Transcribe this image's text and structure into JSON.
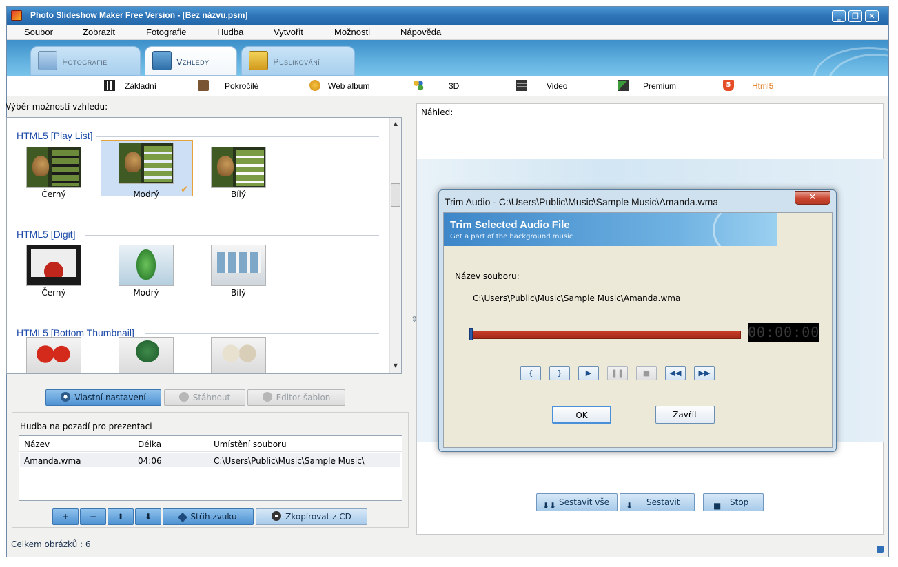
{
  "window": {
    "title": "Photo Slideshow Maker Free Version - [Bez názvu.psm]"
  },
  "menu": [
    "Soubor",
    "Zobrazit",
    "Fotografie",
    "Hudba",
    "Vytvořit",
    "Možnosti",
    "Nápověda"
  ],
  "main_tabs": [
    {
      "label": "Fotografie",
      "icon": "photos-icon"
    },
    {
      "label": "Vzhledy",
      "icon": "themes-icon",
      "active": true
    },
    {
      "label": "Publikování",
      "icon": "publish-icon"
    }
  ],
  "sub_tabs": [
    {
      "label": "Základní",
      "icon": "piano-icon"
    },
    {
      "label": "Pokročilé",
      "icon": "briefcase-icon"
    },
    {
      "label": "Web album",
      "icon": "web-icon"
    },
    {
      "label": "3D",
      "icon": "molecule-icon"
    },
    {
      "label": "Video",
      "icon": "film-icon"
    },
    {
      "label": "Premium",
      "icon": "premium-icon"
    },
    {
      "label": "Html5",
      "icon": "html5-icon",
      "active": true
    }
  ],
  "theme_panel": {
    "label": "Výběr možností vzhledu:",
    "groups": [
      {
        "title": "HTML5 [Play List]",
        "items": [
          "Černý",
          "Modrý",
          "Bílý"
        ],
        "selected": "Modrý"
      },
      {
        "title": "HTML5 [Digit]",
        "items": [
          "Černý",
          "Modrý",
          "Bílý"
        ]
      },
      {
        "title": "HTML5 [Bottom Thumbnail]",
        "items": []
      }
    ],
    "buttons": {
      "custom": "Vlastní nastavení",
      "download": "Stáhnout",
      "editor": "Editor šablon"
    }
  },
  "music": {
    "label": "Hudba na pozadí pro prezentaci",
    "columns": [
      "Název",
      "Délka",
      "Umístění souboru"
    ],
    "rows": [
      {
        "name": "Amanda.wma",
        "length": "04:06",
        "path": "C:\\Users\\Public\\Music\\Sample Music\\"
      }
    ],
    "buttons": {
      "add": "+",
      "remove": "−",
      "up": "⬆",
      "down": "⬇",
      "trim": "Střih zvuku",
      "copy_cd": "Zkopírovat z CD"
    }
  },
  "status": {
    "count_text": "Celkem obrázků : 6"
  },
  "preview": {
    "label": "Náhled:",
    "build_all": "Sestavit vše",
    "build": "Sestavit",
    "stop": "Stop"
  },
  "dialog": {
    "title": "Trim Audio - C:\\Users\\Public\\Music\\Sample Music\\Amanda.wma",
    "close": "✕",
    "banner_title": "Trim Selected Audio File",
    "banner_subtitle": "Get a part of the background music",
    "filename_label": "Název souboru:",
    "filename_value": "C:\\Users\\Public\\Music\\Sample Music\\Amanda.wma",
    "timer": "00:00:00",
    "position": 0,
    "controls": [
      "{",
      "}",
      "▶",
      "❚❚",
      "■",
      "◀◀",
      "▶▶"
    ],
    "ok": "OK",
    "close_button": "Zavřít"
  },
  "colors": {
    "titlebar": "#2e74b8",
    "tabband": "#62b1df",
    "group_title": "#1c4aa8",
    "selection": "#cddff5",
    "trackbar": "#c73e2a",
    "active_subtab": "#e07a1f"
  }
}
